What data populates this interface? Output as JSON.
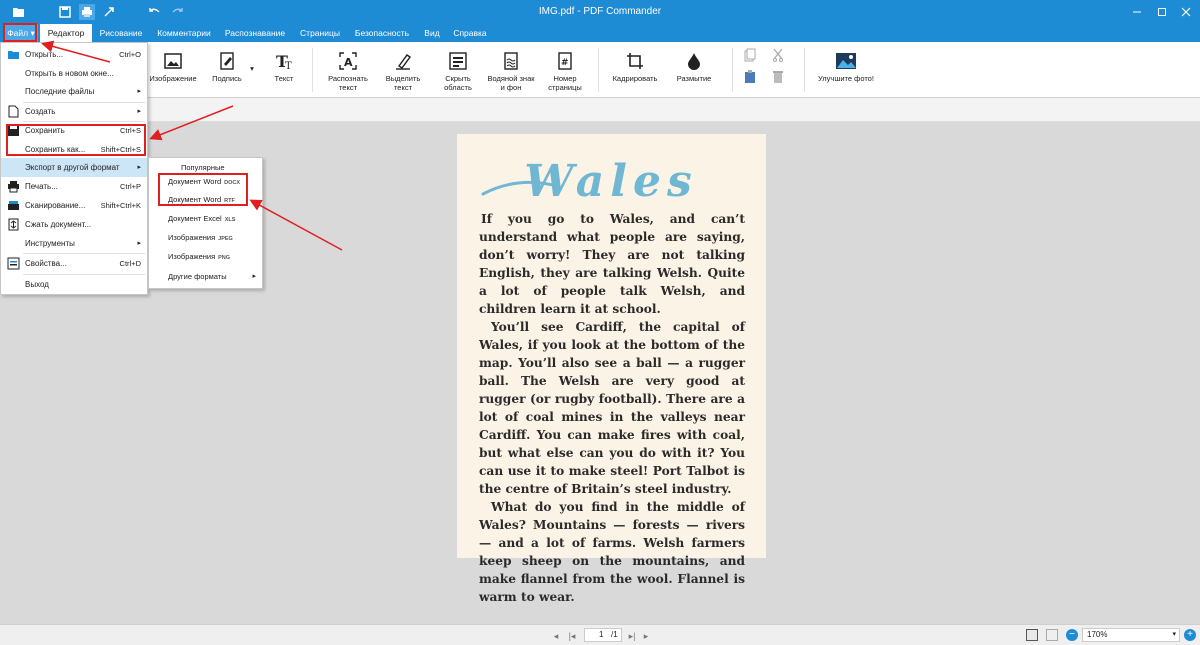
{
  "window": {
    "title": "IMG.pdf - PDF Commander"
  },
  "menu_tabs": [
    {
      "label": "Файл"
    },
    {
      "label": "Редактор"
    },
    {
      "label": "Рисование"
    },
    {
      "label": "Комментарии"
    },
    {
      "label": "Распознавание"
    },
    {
      "label": "Страницы"
    },
    {
      "label": "Безопасность"
    },
    {
      "label": "Вид"
    },
    {
      "label": "Справка"
    }
  ],
  "ribbon": {
    "image": "Изображение",
    "signature": "Подпись",
    "text": "Текст",
    "recognize_1": "Распознать",
    "recognize_2": "текст",
    "select_1": "Выделить",
    "select_2": "текст",
    "hide_1": "Скрыть",
    "hide_2": "область",
    "watermark_1": "Водяной знак",
    "watermark_2": "и фон",
    "pagenum_1": "Номер",
    "pagenum_2": "страницы",
    "crop": "Кадрировать",
    "blur": "Размытие",
    "enhance": "Улучшите фото!"
  },
  "file_menu": {
    "open": "Открыть...",
    "open_sc": "Ctrl+O",
    "open_new": "Открыть в новом окне...",
    "recent": "Последние файлы",
    "create": "Создать",
    "save": "Сохранить",
    "save_sc": "Ctrl+S",
    "save_as": "Сохранить как...",
    "save_as_sc": "Shift+Ctrl+S",
    "export": "Экспорт в другой формат",
    "print": "Печать...",
    "print_sc": "Ctrl+P",
    "scan": "Сканирование...",
    "scan_sc": "Shift+Ctrl+K",
    "compress": "Сжать документ...",
    "tools": "Инструменты",
    "properties": "Свойства...",
    "properties_sc": "Ctrl+D",
    "exit": "Выход"
  },
  "export_submenu": {
    "popular": "Популярные",
    "word_docx": "Документ Word",
    "word_docx_sfx": "DOCX",
    "word_rtf": "Документ Word",
    "word_rtf_sfx": "RTF",
    "excel": "Документ Excel",
    "excel_sfx": "XLS",
    "jpeg": "Изображения",
    "jpeg_sfx": "JPEG",
    "png": "Изображения",
    "png_sfx": "PNG",
    "other": "Другие форматы"
  },
  "document": {
    "heading": "Wales",
    "paragraphs": [
      "If you go to Wales, and can’t understand what people are saying, don’t worry! They are not talking English, they are talking Welsh. Quite a lot of people talk Welsh, and children learn it at school.",
      "You’ll see Cardiff, the capital of Wales, if you look at the bottom of the map. You’ll also see a ball — a rugger ball. The Welsh are very good at rugger (or rugby football). There are a lot of coal mines in the valleys near Cardiff. You can make fires with coal, but what else can you do with it? You can use it to make steel! Port Talbot is the centre of Britain’s steel industry.",
      "What do you find in the middle of Wales? Mountains — forests — rivers — and a lot of farms. Welsh farmers keep sheep on the mountains, and make flannel from the wool. Flannel is warm to wear."
    ]
  },
  "statusbar": {
    "page_current": "1",
    "page_total": "/1",
    "zoom": "170%"
  },
  "colors": {
    "titlebar": "#1e8bd5",
    "highlight": "#cde6f7",
    "annotation": "#e02020",
    "heading_blue": "#6fb7d3"
  }
}
